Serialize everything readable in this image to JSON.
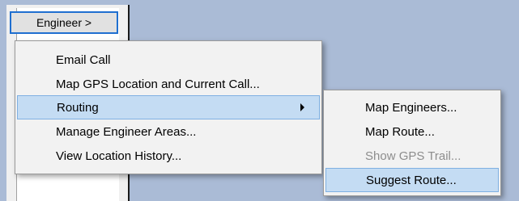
{
  "engineer_button": {
    "label": "Engineer >"
  },
  "menu": {
    "items": [
      {
        "label": "Email Call"
      },
      {
        "label": "Map GPS Location and Current Call..."
      },
      {
        "label": "Routing"
      },
      {
        "label": "Manage Engineer Areas..."
      },
      {
        "label": "View Location History..."
      }
    ]
  },
  "submenu": {
    "items": [
      {
        "label": "Map Engineers..."
      },
      {
        "label": "Map Route..."
      },
      {
        "label": "Show GPS Trail..."
      },
      {
        "label": "Suggest Route..."
      }
    ]
  },
  "colors": {
    "highlight": "#c4dcf3",
    "highlight_border": "#7fb0e2",
    "disabled_text": "#8d8d8d",
    "button_border": "#1f6fd0",
    "background": "#aabbd6"
  },
  "icons": [
    "submenu-arrow-icon"
  ]
}
